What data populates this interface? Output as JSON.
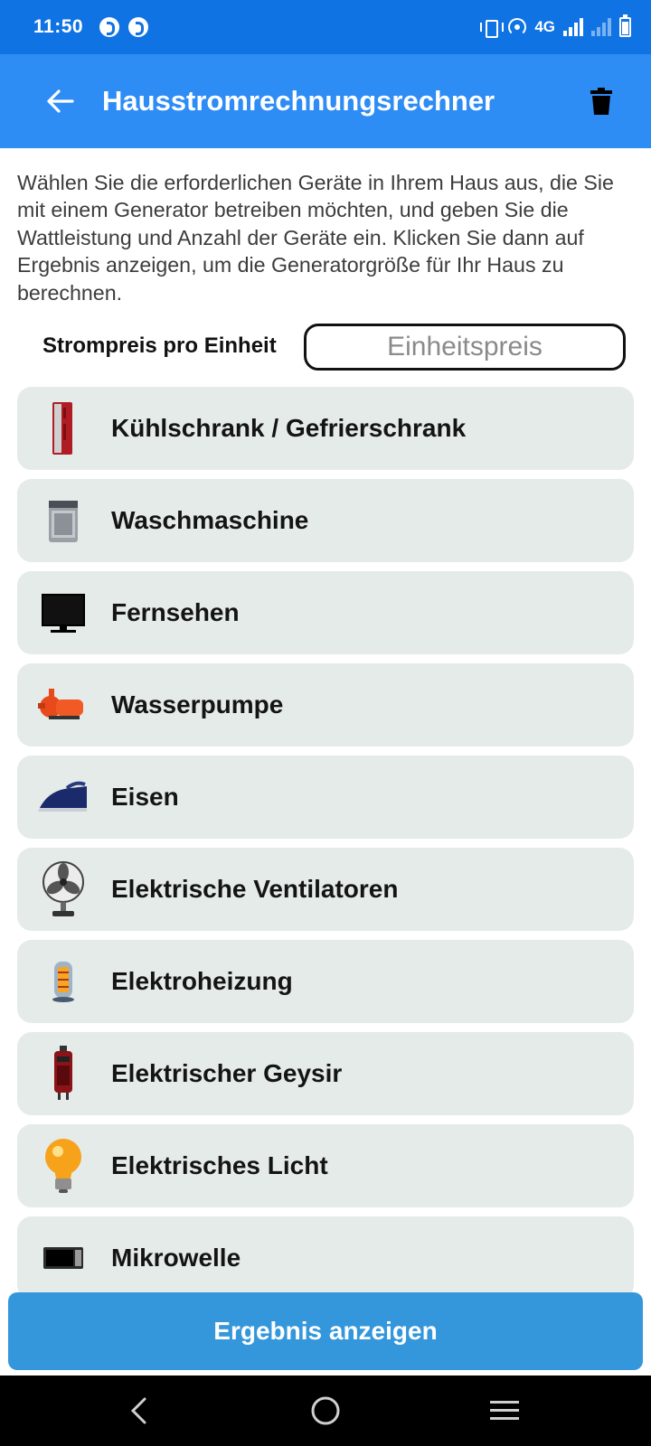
{
  "status_bar": {
    "time": "11:50",
    "network": "4G"
  },
  "app_bar": {
    "title": "Hausstromrechnungsrechner"
  },
  "intro_text": "Wählen Sie die erforderlichen Geräte in Ihrem Haus aus, die Sie mit einem Generator betreiben möchten, und geben Sie die Wattleistung und Anzahl der Geräte ein. Klicken Sie dann auf Ergebnis anzeigen, um die Generatorgröße für Ihr Haus zu berechnen.",
  "price": {
    "label": "Strompreis pro Einheit",
    "placeholder": "Einheitspreis",
    "value": ""
  },
  "appliances": [
    {
      "label": "Kühlschrank / Gefrierschrank",
      "icon": "refrigerator-icon"
    },
    {
      "label": "Waschmaschine",
      "icon": "washing-machine-icon"
    },
    {
      "label": "Fernsehen",
      "icon": "television-icon"
    },
    {
      "label": "Wasserpumpe",
      "icon": "water-pump-icon"
    },
    {
      "label": "Eisen",
      "icon": "iron-icon"
    },
    {
      "label": "Elektrische Ventilatoren",
      "icon": "fan-icon"
    },
    {
      "label": "Elektroheizung",
      "icon": "heater-icon"
    },
    {
      "label": "Elektrischer Geysir",
      "icon": "geyser-icon"
    },
    {
      "label": "Elektrisches Licht",
      "icon": "light-bulb-icon"
    },
    {
      "label": "Mikrowelle",
      "icon": "microwave-icon"
    }
  ],
  "result_button": "Ergebnis anzeigen",
  "colors": {
    "status_bar": "#0f73e4",
    "app_bar": "#2e8cf5",
    "item_bg": "#e4ebe9",
    "button": "#3497dc"
  }
}
